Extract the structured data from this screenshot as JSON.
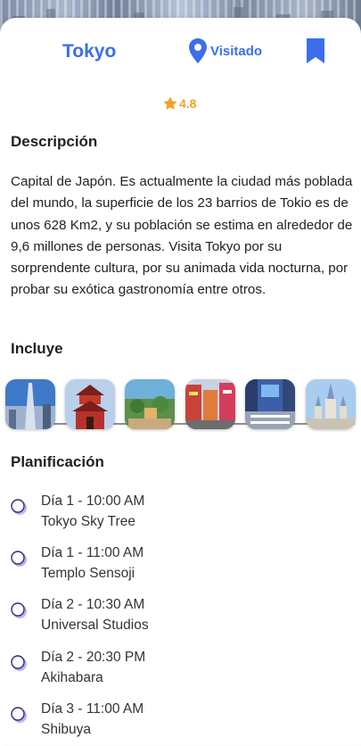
{
  "place": {
    "name": "Tokyo",
    "visited_label": "Visitado",
    "rating": "4.8"
  },
  "colors": {
    "accent": "#3b6ee8",
    "star": "#f2a02a",
    "timeline_dot": "#b7b4f5"
  },
  "sections": {
    "description_title": "Descripción",
    "includes_title": "Incluye",
    "planning_title": "Planificación"
  },
  "description": "Capital de Japón. Es actualmente la ciudad más poblada del mundo, la superficie de los 23 barrios de Tokio es de unos 628 Km2, y su población se estima en alrededor de 9,6 millones de personas. Visita Tokyo por su sorprendente cultura, por su animada vida nocturna, por probar su exótica gastronomía entre otros.",
  "icons": {
    "visited": "location-pin-icon",
    "bookmark": "bookmark-icon",
    "rating": "star-icon",
    "timeline": "circle-dot-icon"
  },
  "gallery": [
    {
      "id": "photo-1"
    },
    {
      "id": "photo-2"
    },
    {
      "id": "photo-3"
    },
    {
      "id": "photo-4"
    },
    {
      "id": "photo-5"
    },
    {
      "id": "photo-6"
    }
  ],
  "planning": [
    {
      "when": "Día 1 - 10:00 AM",
      "place": "Tokyo Sky Tree"
    },
    {
      "when": "Día 1 - 11:00 AM",
      "place": "Templo Sensoji"
    },
    {
      "when": "Día 2 - 10:30 AM",
      "place": "Universal Studios"
    },
    {
      "when": "Día 2 - 20:30 PM",
      "place": "Akihabara"
    },
    {
      "when": "Día 3 - 11:00 AM",
      "place": "Shibuya"
    }
  ]
}
